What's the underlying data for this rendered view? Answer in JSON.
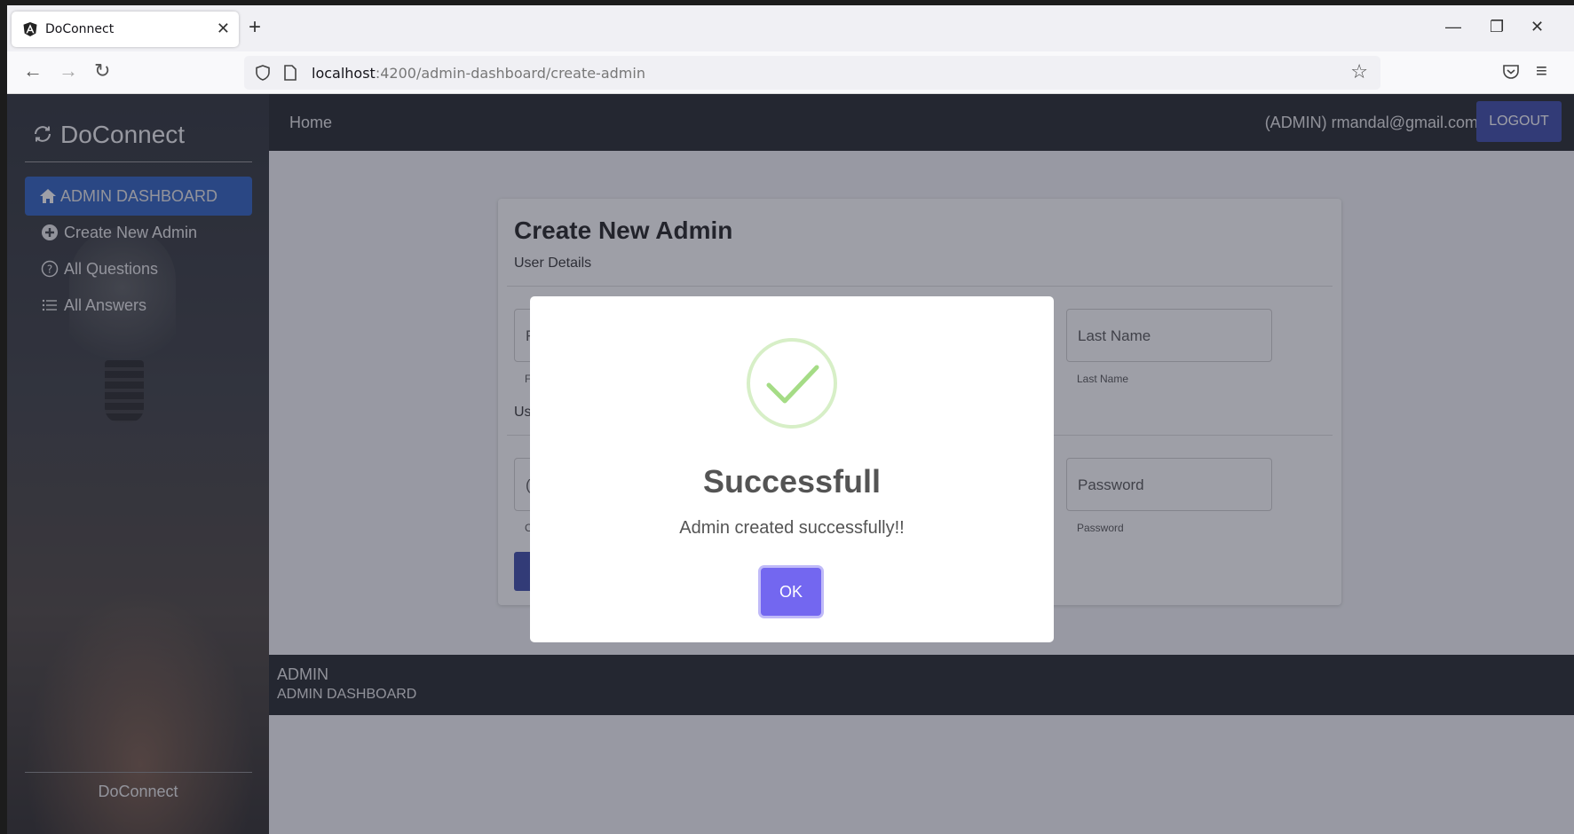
{
  "browser": {
    "tab_title": "DoConnect",
    "url_host": "localhost",
    "url_path": ":4200/admin-dashboard/create-admin"
  },
  "sidebar": {
    "brand": "DoConnect",
    "items": [
      {
        "label": "ADMIN DASHBOARD",
        "icon": "home-icon",
        "active": true
      },
      {
        "label": "Create New Admin",
        "icon": "plus-circle-icon",
        "active": false
      },
      {
        "label": "All Questions",
        "icon": "question-circle-icon",
        "active": false
      },
      {
        "label": "All Answers",
        "icon": "list-icon",
        "active": false
      }
    ],
    "footer": "DoConnect"
  },
  "topnav": {
    "home": "Home",
    "user": "(ADMIN) rmandal@gmail.com",
    "logout": "LOGOUT"
  },
  "form": {
    "title": "Create New Admin",
    "section_user_details": "User Details",
    "first_name_placeholder_fragment": "F",
    "first_name_hint_fragment": "F",
    "last_name_placeholder": "Last Name",
    "last_name_hint": "Last Name",
    "section2_fragment": "Us",
    "email_placeholder_fragment": "(",
    "email_hint_fragment": "C",
    "password_placeholder": "Password",
    "password_hint": "Password"
  },
  "footer": {
    "line1": "ADMIN",
    "line2": "ADMIN DASHBOARD"
  },
  "modal": {
    "title": "Successfull",
    "message": "Admin created successfully!!",
    "ok_label": "OK",
    "accent_color": "#7367f0",
    "check_color": "#a5dc86"
  }
}
